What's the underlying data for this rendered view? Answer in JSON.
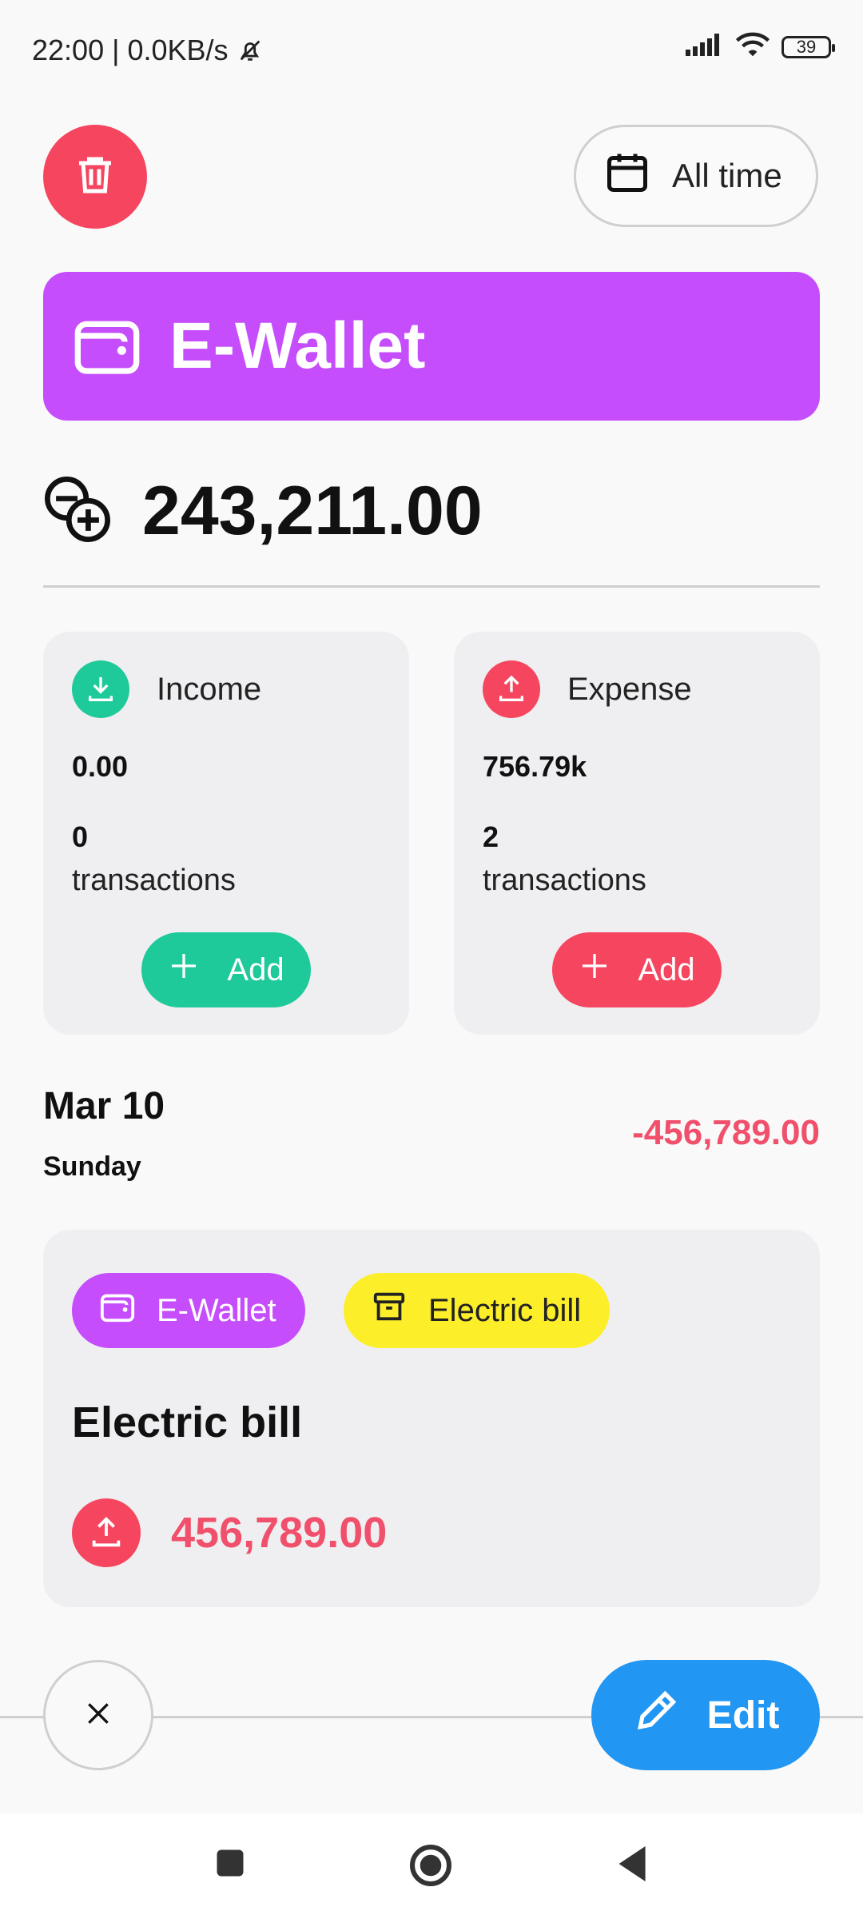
{
  "status_bar": {
    "time_speed": "22:00 | 0.0KB/s",
    "battery": "39"
  },
  "toolbar": {
    "period_label": "All time"
  },
  "wallet": {
    "name": "E-Wallet",
    "balance": "243,211.00",
    "color": "#c54dfb"
  },
  "income_card": {
    "label": "Income",
    "amount": "0.00",
    "count": "0",
    "count_label": "transactions",
    "add_label": "Add",
    "color": "#1ec99a"
  },
  "expense_card": {
    "label": "Expense",
    "amount": "756.79k",
    "count": "2",
    "count_label": "transactions",
    "add_label": "Add",
    "color": "#f6455f"
  },
  "date_group": {
    "date": "Mar 10",
    "weekday": "Sunday",
    "total": "-456,789.00"
  },
  "transaction": {
    "wallet_chip": "E-Wallet",
    "category_chip": "Electric bill",
    "title": "Electric bill",
    "amount": "456,789.00",
    "category_color": "#fcee29"
  },
  "actions": {
    "edit_label": "Edit",
    "edit_color": "#2196f3"
  },
  "icons": [
    "trash-icon",
    "calendar-icon",
    "wallet-icon",
    "balance-icon",
    "income-icon",
    "expense-icon",
    "plus-icon",
    "archive-icon",
    "close-icon",
    "pencil-icon"
  ]
}
